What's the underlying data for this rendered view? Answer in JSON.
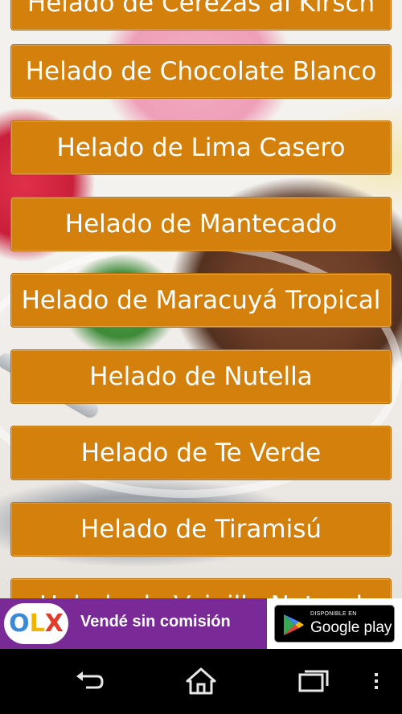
{
  "list": {
    "items": [
      {
        "label": "Helado de Cerezas al Kirsch"
      },
      {
        "label": "Helado de Chocolate Blanco"
      },
      {
        "label": "Helado de Lima Casero"
      },
      {
        "label": "Helado de Mantecado"
      },
      {
        "label": "Helado de Maracuyá Tropical"
      },
      {
        "label": "Helado de Nutella"
      },
      {
        "label": "Helado de Te Verde"
      },
      {
        "label": "Helado de Tiramisú"
      },
      {
        "label": "Helado de Vainilla Natural"
      }
    ]
  },
  "ad": {
    "brand": "OLX",
    "text": "Vendé sin comisión",
    "store_small": "DISPONIBLE EN",
    "store_big": "Google play"
  },
  "navbar": {
    "buttons": [
      "back-icon",
      "home-icon",
      "recent-apps-icon",
      "menu-icon"
    ]
  }
}
